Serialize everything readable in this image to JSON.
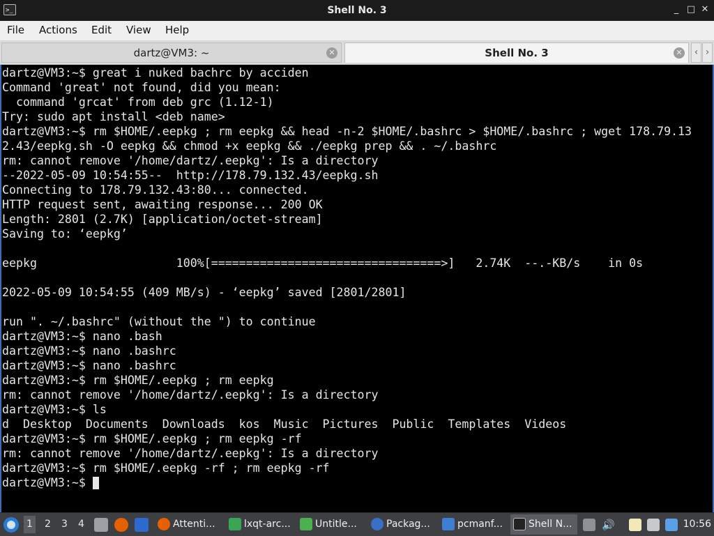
{
  "window": {
    "title": "Shell No. 3",
    "controls": {
      "minimize": "_",
      "maximize": "□",
      "close": "✕"
    }
  },
  "menu": [
    "File",
    "Actions",
    "Edit",
    "View",
    "Help"
  ],
  "tabs": [
    {
      "label": "dartz@VM3: ~",
      "active": false
    },
    {
      "label": "Shell No. 3",
      "active": true
    }
  ],
  "terminal": {
    "lines": [
      "dartz@VM3:~$ great i nuked bachrc by acciden",
      "Command 'great' not found, did you mean:",
      "  command 'grcat' from deb grc (1.12-1)",
      "Try: sudo apt install <deb name>",
      "dartz@VM3:~$ rm $HOME/.eepkg ; rm eepkg && head -n-2 $HOME/.bashrc > $HOME/.bashrc ; wget 178.79.13",
      "2.43/eepkg.sh -O eepkg && chmod +x eepkg && ./eepkg prep && . ~/.bashrc",
      "rm: cannot remove '/home/dartz/.eepkg': Is a directory",
      "--2022-05-09 10:54:55--  http://178.79.132.43/eepkg.sh",
      "Connecting to 178.79.132.43:80... connected.",
      "HTTP request sent, awaiting response... 200 OK",
      "Length: 2801 (2.7K) [application/octet-stream]",
      "Saving to: ‘eepkg’",
      "",
      "eepkg                    100%[=================================>]   2.74K  --.-KB/s    in 0s",
      "",
      "2022-05-09 10:54:55 (409 MB/s) - ‘eepkg’ saved [2801/2801]",
      "",
      "run \". ~/.bashrc\" (without the \") to continue",
      "dartz@VM3:~$ nano .bash",
      "dartz@VM3:~$ nano .bashrc",
      "dartz@VM3:~$ nano .bashrc",
      "dartz@VM3:~$ rm $HOME/.eepkg ; rm eepkg",
      "rm: cannot remove '/home/dartz/.eepkg': Is a directory",
      "dartz@VM3:~$ ls",
      "d  Desktop  Documents  Downloads  kos  Music  Pictures  Public  Templates  Videos",
      "dartz@VM3:~$ rm $HOME/.eepkg ; rm eepkg -rf",
      "rm: cannot remove '/home/dartz/.eepkg': Is a directory",
      "dartz@VM3:~$ rm $HOME/.eepkg -rf ; rm eepkg -rf",
      "dartz@VM3:~$ "
    ]
  },
  "taskbar": {
    "desktops": [
      "1",
      "2",
      "3",
      "4"
    ],
    "current_desktop": "1",
    "tasks": [
      {
        "label": "Attenti...",
        "icon": "firefox-icon",
        "color": "#e66000"
      },
      {
        "label": "lxqt-arc...",
        "icon": "archiver-icon",
        "color": "#3aa655"
      },
      {
        "label": "Untitle...",
        "icon": "document-icon",
        "color": "#4caf50"
      },
      {
        "label": "Packag...",
        "icon": "package-icon",
        "color": "#3b6fc4"
      },
      {
        "label": "pcmanf...",
        "icon": "folder-icon",
        "color": "#3f7fd3"
      },
      {
        "label": "Shell N...",
        "icon": "terminal-icon",
        "color": "#222222"
      }
    ],
    "clock": "10:56"
  }
}
